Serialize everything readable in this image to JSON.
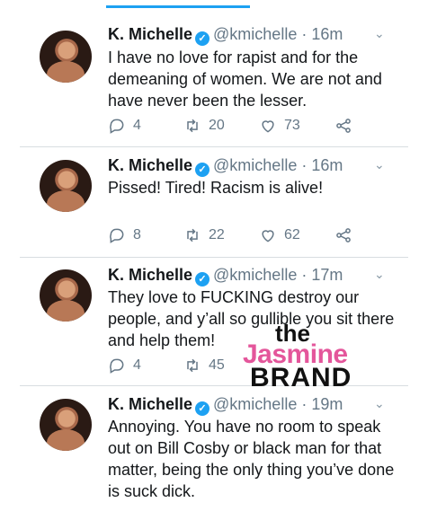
{
  "tweets": [
    {
      "name": "K. Michelle",
      "handle": "@kmichelle",
      "time": "16m",
      "text": "I have no love for rapist and for the demeaning of women. We are not and have never been the lesser.",
      "replies": "4",
      "retweets": "20",
      "likes": "73"
    },
    {
      "name": "K. Michelle",
      "handle": "@kmichelle",
      "time": "16m",
      "text": "Pissed! Tired! Racism is alive!",
      "replies": "8",
      "retweets": "22",
      "likes": "62"
    },
    {
      "name": "K. Michelle",
      "handle": "@kmichelle",
      "time": "17m",
      "text": "They love to FUCKING destroy our people, and y’all so gullible you sit there and help them!",
      "replies": "4",
      "retweets": "45",
      "likes": ""
    },
    {
      "name": "K. Michelle",
      "handle": "@kmichelle",
      "time": "19m",
      "text": "Annoying. You have no room to speak out on Bill Cosby or black man for that matter, being the only thing you’ve done is suck dick.",
      "replies": "",
      "retweets": "",
      "likes": ""
    }
  ],
  "separator": "·",
  "verified_glyph": "✓",
  "chevron_glyph": "⌄",
  "watermark": {
    "line1": "the",
    "line2": "Jasmine",
    "line3": "BRAND"
  },
  "colors": {
    "accent": "#1da1f2",
    "watermark_pink": "#e4569b",
    "muted": "#657786"
  },
  "icons": {
    "reply": "reply-icon",
    "retweet": "retweet-icon",
    "like": "heart-icon",
    "share": "share-icon",
    "verified": "verified-badge-icon",
    "menu": "chevron-down-icon"
  }
}
